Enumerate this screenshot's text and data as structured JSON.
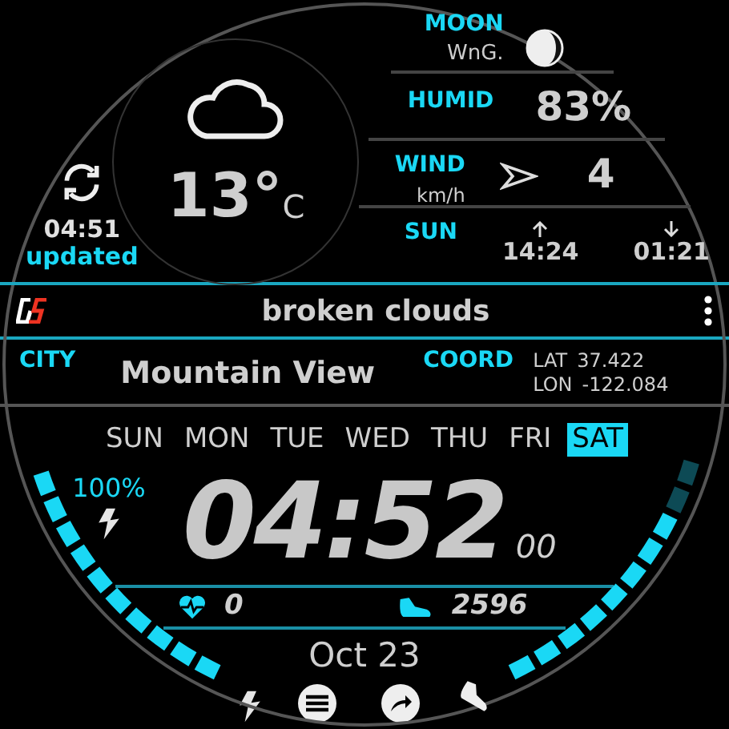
{
  "weather": {
    "temperature": "13°",
    "unit": "C",
    "updated_time": "04:51",
    "updated_label": "updated",
    "condition": "broken clouds"
  },
  "moon": {
    "label": "MOON",
    "phase": "WnG."
  },
  "humidity": {
    "label": "HUMID",
    "value": "83%"
  },
  "wind": {
    "label": "WIND",
    "unit": "km/h",
    "value": "4"
  },
  "sun": {
    "label": "SUN",
    "sunrise": "14:24",
    "sunset": "01:21"
  },
  "city": {
    "label": "CITY",
    "value": "Mountain View"
  },
  "coord": {
    "label": "COORD",
    "lat_label": "LAT",
    "lat": "37.422",
    "lon_label": "LON",
    "lon": "-122.084"
  },
  "days": [
    {
      "label": "SUN",
      "selected": false
    },
    {
      "label": "MON",
      "selected": false
    },
    {
      "label": "TUE",
      "selected": false
    },
    {
      "label": "WED",
      "selected": false
    },
    {
      "label": "THU",
      "selected": false
    },
    {
      "label": "FRI",
      "selected": false
    },
    {
      "label": "SAT",
      "selected": true
    }
  ],
  "battery": {
    "value": "100%"
  },
  "time": {
    "hours_minutes": "04:52",
    "seconds": "00"
  },
  "heart_rate": "0",
  "steps": {
    "value": "2596"
  },
  "date": "Oct 23"
}
